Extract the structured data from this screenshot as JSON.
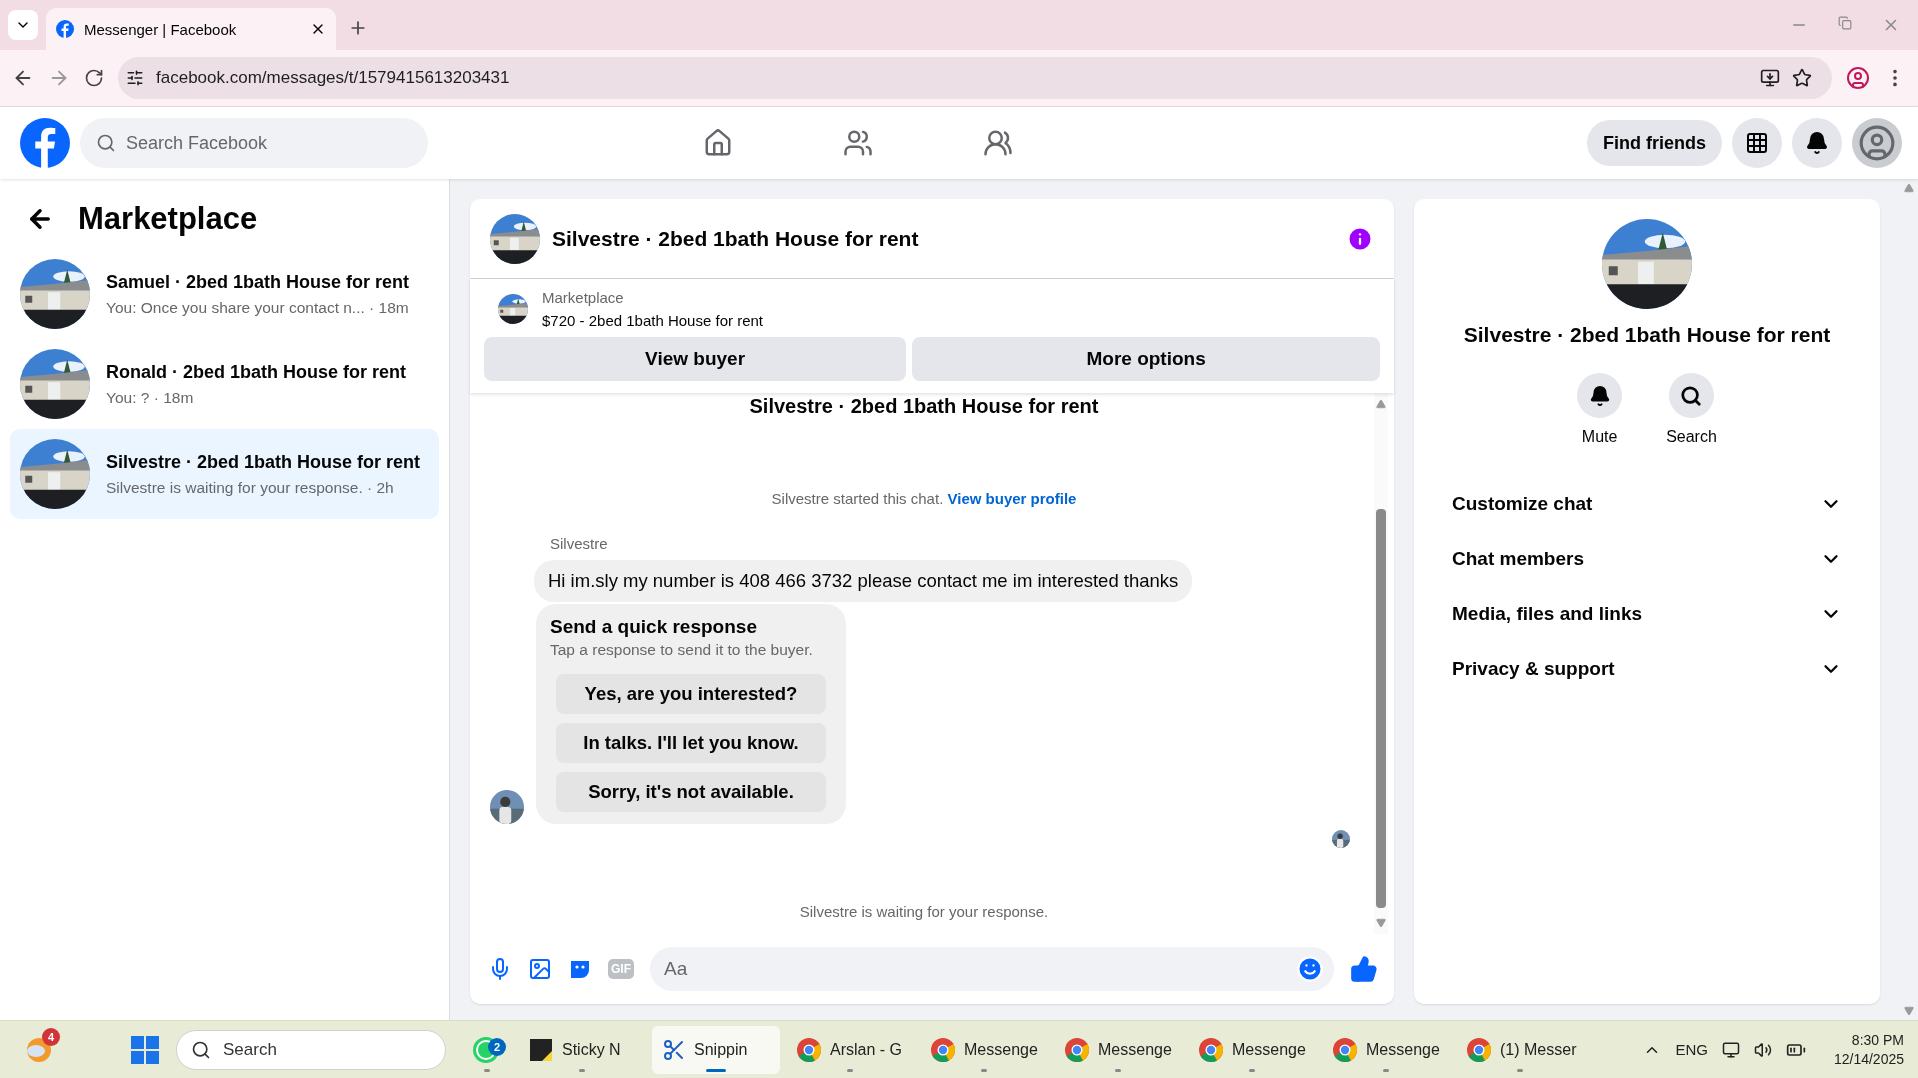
{
  "browser": {
    "tab": {
      "title": "Messenger | Facebook",
      "selected": true
    },
    "url": "facebook.com/messages/t/1579415613203431"
  },
  "header": {
    "search_placeholder": "Search Facebook",
    "find_friends": "Find friends"
  },
  "sidebar": {
    "title": "Marketplace",
    "conversations": [
      {
        "title": "Samuel · 2bed 1bath House for rent",
        "subtitle": "You: Once you share your contact n... · 18m",
        "selected": false
      },
      {
        "title": "Ronald · 2bed 1bath House for rent",
        "subtitle": "You: ? · 18m",
        "selected": false
      },
      {
        "title": "Silvestre · 2bed 1bath House for rent",
        "subtitle": "Silvestre is waiting for your response. · 2h",
        "selected": true
      }
    ]
  },
  "chat": {
    "title": "Silvestre · 2bed 1bath House for rent",
    "listing": {
      "source": "Marketplace",
      "summary": "$720 - 2bed 1bath House for rent"
    },
    "actions": [
      "View buyer",
      "More options"
    ],
    "thread_title": "Silvestre · 2bed 1bath House for rent",
    "started": {
      "text": "Silvestre started this chat.",
      "link": "View buyer profile"
    },
    "sender": "Silvestre",
    "message": "Hi im.sly my number is 408 466 3732 please contact me im interested thanks",
    "quick_response": {
      "title": "Send a quick response",
      "hint": "Tap a response to send it to the buyer.",
      "options": [
        "Yes, are you interested?",
        "In talks. I'll let you know.",
        "Sorry, it's not available."
      ]
    },
    "status": "Silvestre is waiting for your response.",
    "composer": {
      "gif": "GIF",
      "placeholder": "Aa"
    }
  },
  "details": {
    "title": "Silvestre · 2bed 1bath House for rent",
    "actions": [
      {
        "kind": "mute",
        "label": "Mute"
      },
      {
        "kind": "search",
        "label": "Search"
      }
    ],
    "sections": [
      {
        "label": "Customize chat",
        "expanded": false
      },
      {
        "label": "Chat members",
        "expanded": false
      },
      {
        "label": "Media, files and links",
        "expanded": false
      },
      {
        "label": "Privacy & support",
        "expanded": false
      }
    ]
  },
  "taskbar": {
    "weather_badge": "4",
    "search_placeholder": "Search",
    "apps": [
      {
        "kind": "whatsapp",
        "badge": "2",
        "selected": false
      },
      {
        "kind": "sticky",
        "label": "Sticky N",
        "selected": false
      },
      {
        "kind": "snipping",
        "label": "Snippin",
        "selected": true
      },
      {
        "kind": "chrome",
        "label": "Arslan - G",
        "selected": false
      },
      {
        "kind": "chrome",
        "label": "Messenge",
        "selected": false
      },
      {
        "kind": "chrome",
        "label": "Messenge",
        "selected": false
      },
      {
        "kind": "chrome",
        "label": "Messenge",
        "selected": false
      },
      {
        "kind": "chrome",
        "label": "Messenge",
        "selected": false
      },
      {
        "kind": "chrome",
        "label": "(1) Messer",
        "selected": false
      }
    ],
    "language": "ENG",
    "time": "8:30 PM",
    "date": "12/14/2025"
  }
}
